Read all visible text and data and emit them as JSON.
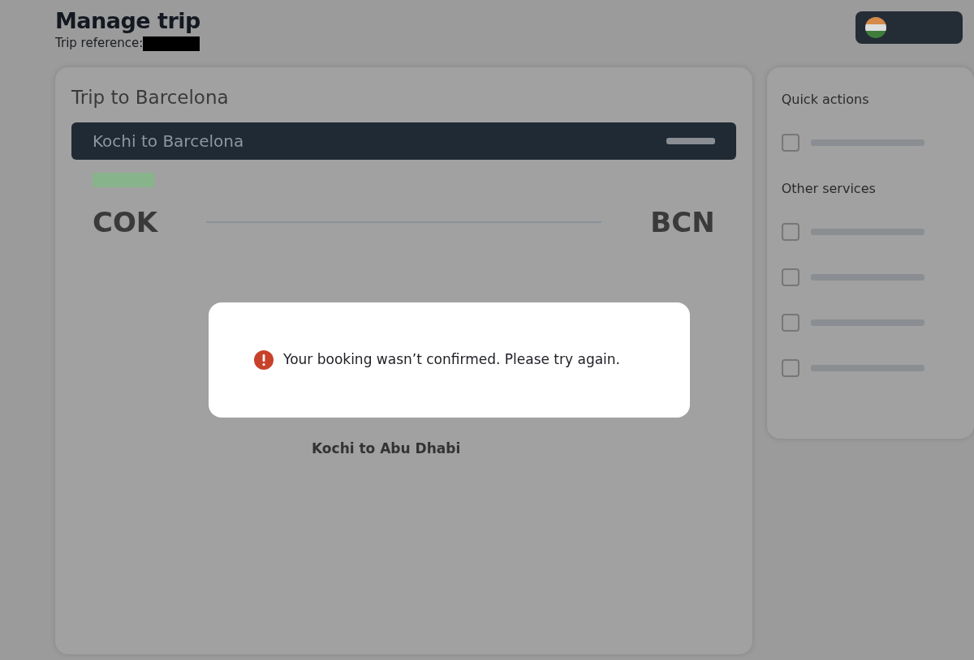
{
  "header": {
    "title": "Manage trip",
    "reference_label": "Trip reference:"
  },
  "trip_card": {
    "title": "Trip to Barcelona",
    "flight_bar": {
      "title": "Kochi to Barcelona"
    },
    "origin": {
      "code": "COK"
    },
    "destination": {
      "code": "BCN"
    },
    "segment": {
      "title": "Kochi to Abu Dhabi"
    }
  },
  "side_panel": {
    "sections": [
      {
        "title": "Quick actions"
      },
      {
        "title": "Other services"
      }
    ]
  },
  "dialog": {
    "kind": "error",
    "message": "Your booking wasn’t confirmed. Please try again."
  }
}
